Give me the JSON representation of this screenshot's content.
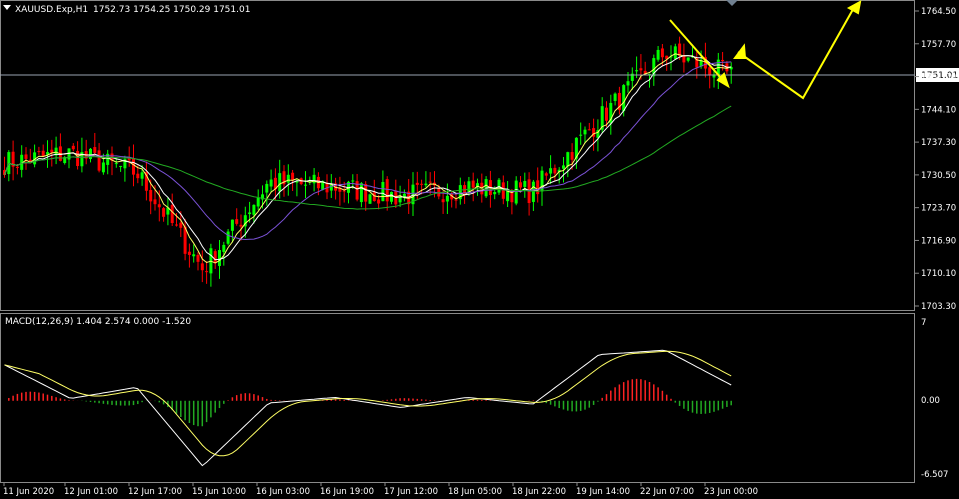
{
  "header": {
    "symbol_label": "XAUUSD.Exp,H1",
    "ohlc_text": "1752.73 1754.25 1750.29 1751.01"
  },
  "colors": {
    "bull": "#00ff00",
    "bear": "#ff0000",
    "ma_fast": "#ffff66",
    "ma_mid": "#ffffff",
    "ma_slow": "#7b52d6",
    "ma_long": "#22aa22",
    "arrow": "#ffff00",
    "macd_line": "#ffffff",
    "signal_line": "#ffff66",
    "hist_pos": "#ff2222",
    "hist_neg": "#22aa22",
    "grid_border": "#8a8a8a"
  },
  "price_panel": {
    "y_ticks": [
      "1764.50",
      "1757.70",
      "1751.00",
      "1744.10",
      "1737.30",
      "1730.50",
      "1723.70",
      "1716.90",
      "1710.10",
      "1703.30"
    ],
    "current_price": "1751.01"
  },
  "macd_panel": {
    "label": "MACD(12,26,9) 1.404 2.574 0.000 -1.520",
    "y_ticks": [
      "7",
      "0.00",
      "-6.507"
    ]
  },
  "time_axis": [
    "11 Jun 2020",
    "12 Jun 01:00",
    "12 Jun 17:00",
    "15 Jun 10:00",
    "16 Jun 03:00",
    "16 Jun 19:00",
    "17 Jun 12:00",
    "18 Jun 05:00",
    "18 Jun 22:00",
    "19 Jun 14:00",
    "22 Jun 07:00",
    "23 Jun 00:00"
  ],
  "chart_data": [
    {
      "type": "line",
      "title": "",
      "series_note": "Approximate close path of XAUUSD H1 candles",
      "ylim": [
        1703.3,
        1764.5
      ],
      "x": [
        "11 Jun 2020",
        "12 Jun 01:00",
        "12 Jun 17:00",
        "15 Jun 10:00",
        "16 Jun 03:00",
        "16 Jun 19:00",
        "17 Jun 12:00",
        "18 Jun 05:00",
        "18 Jun 22:00",
        "19 Jun 14:00",
        "22 Jun 07:00",
        "23 Jun 00:00"
      ],
      "series": [
        {
          "name": "",
          "values": [
            1733,
            1735,
            1731,
            1711,
            1729,
            1728,
            1726,
            1728,
            1727,
            1742,
            1756,
            1751
          ]
        }
      ]
    },
    {
      "type": "bar",
      "title": "",
      "ylim": [
        -6.507,
        7
      ],
      "categories": [
        "11 Jun 2020",
        "12 Jun 01:00",
        "12 Jun 17:00",
        "15 Jun 10:00",
        "16 Jun 03:00",
        "16 Jun 19:00",
        "17 Jun 12:00",
        "18 Jun 05:00",
        "18 Jun 22:00",
        "19 Jun 14:00",
        "22 Jun 07:00",
        "23 Jun 00:00"
      ],
      "series": [
        {
          "name": "",
          "values": [
            3.2,
            0.2,
            1.2,
            -5.8,
            -0.2,
            0.3,
            -0.6,
            0.3,
            -0.3,
            4.1,
            4.5,
            1.4
          ]
        }
      ]
    }
  ]
}
